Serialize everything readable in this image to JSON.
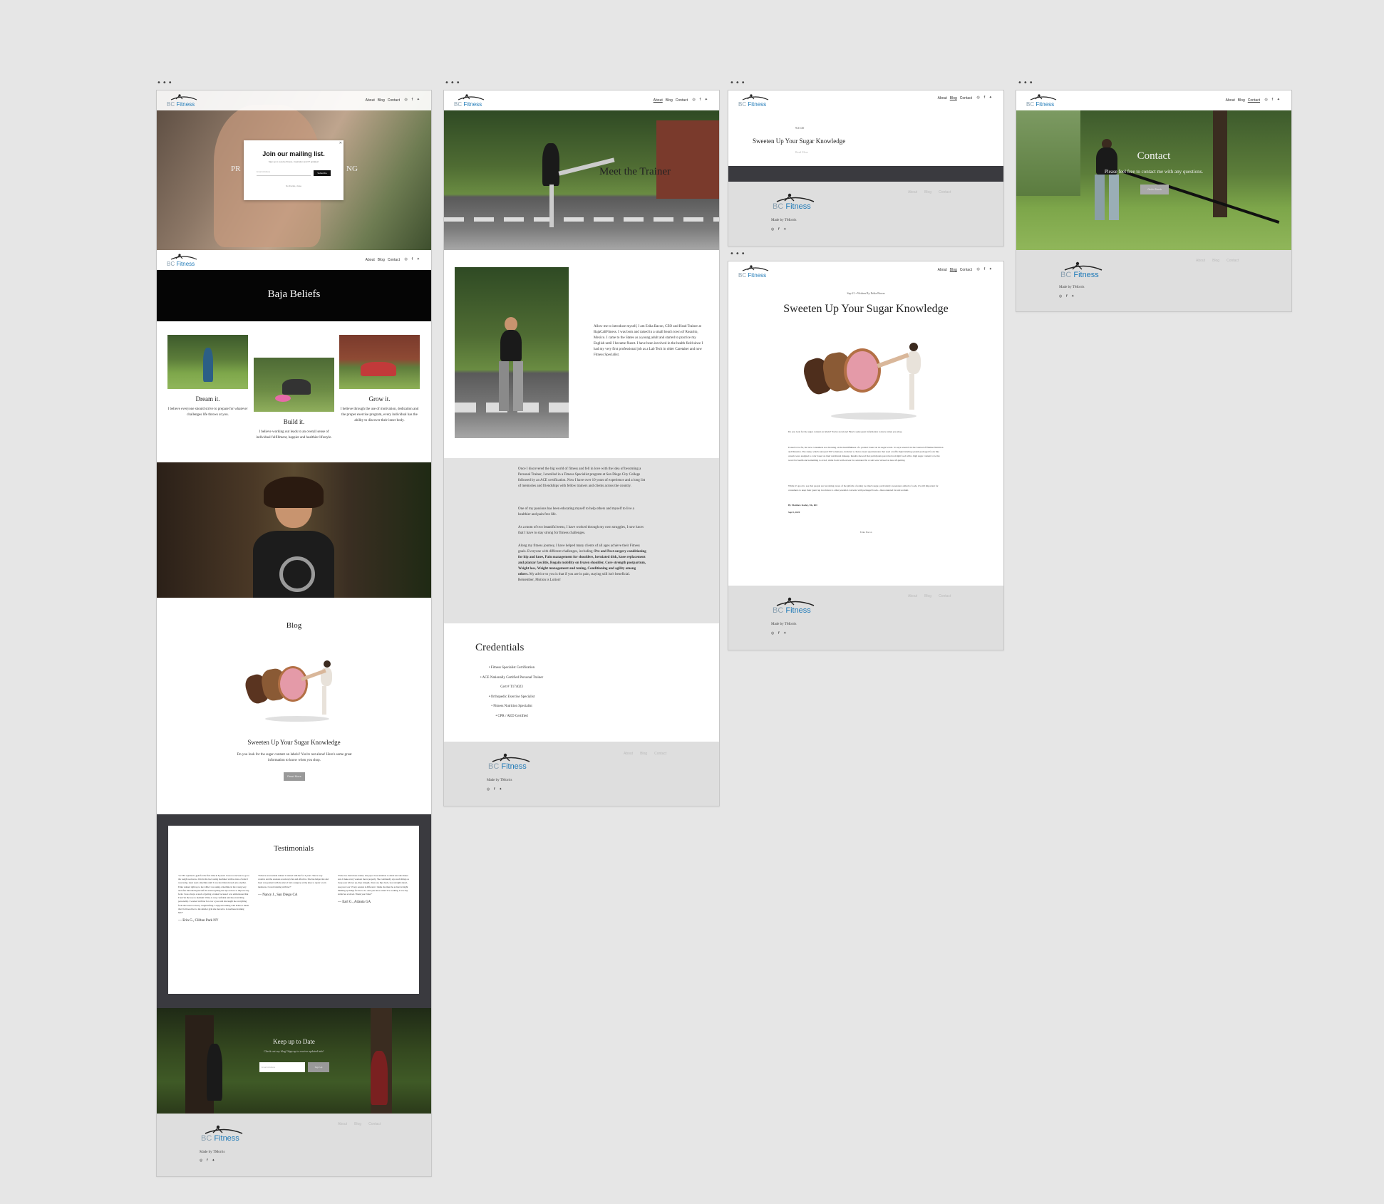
{
  "nav": {
    "logo_bc": "BC",
    "logo_fitness": "Fitness",
    "links": [
      "About",
      "Blog",
      "Contact"
    ],
    "social_icons": [
      "instagram-icon",
      "facebook-icon",
      "twitter-icon"
    ],
    "social_glyphs": "◎ f ✦"
  },
  "colors": {
    "page_bg": "#e6e6e6",
    "brand": "#1f7ab8",
    "footer_bg": "#dedede",
    "dark_band": "#3a3a3f"
  },
  "home": {
    "hero_left": "PR",
    "hero_right": "NG",
    "popup": {
      "title": "Join our mailing list.",
      "subtitle": "Sign up to receive fitness, inspiration and IT updates!",
      "email_placeholder": "Email Address",
      "submit": "Subscribe",
      "no_thanks": "No thanks, close"
    },
    "beliefs_title": "Baja Beliefs",
    "beliefs": [
      {
        "title": "Dream it.",
        "text": "I believe everyone should strive to prepare for whatever challenges life throws at you."
      },
      {
        "title": "Build it.",
        "text": "I believe working out leads to an overall sense of individual fulfillment, happier and healthier lifestyle."
      },
      {
        "title": "Grow it.",
        "text": "I believe through the use of motivation, dedication and the proper exercise program, every individual has the ability to discover their inner body."
      }
    ],
    "blog_title": "Blog",
    "blog_post_title": "Sweeten Up Your Sugar Knowledge",
    "blog_post_excerpt": "Do you look for the sugar content on labels? You're not alone! Here's some great information to know when you shop.",
    "read_more": "Read More",
    "testimonials_title": "Testimonials",
    "testimonials": [
      {
        "quote": "\"At 58 I rejoined a gym for the first time in 8 years! I was too nervous to go to the weight section so I hid in the back using machines with no idea of what I was doing. I just used a machine until I was tired then moved onto another. Erika walked right up to me while I was using a machine in the wrong way and after introducing herself she started giving me tips on how to improve my form. I was always scared of getting a trainer because I was embarrassed that I had 'let the lose to medium'. Erika is very confident and has an inviting personality. I worked with her for over a year and she taught me everything from the basics to heavy weight lifting. I enjoyed training with Erika so much that I followed her to the smaller gym she moved to in northeast training hub!\"",
        "author": "— Erin G., Clifton Park NY"
      },
      {
        "quote": "\"Erika is an excellent trainer! I trained with her for 3 years. She is very creative and the sessions are always fun and effective. She has helped me and been very patient with me since I had a surgery on my knee to repair a torn meniscus. I loved training with her!\"",
        "author": "— Nancy J., San Diego CA"
      },
      {
        "quote": "\"Erika is a marvelous trainer, she pays close attention to detail and she makes sure I make every workout move properly. She continually says such things as 'keep your elbows up, hips straight, chest out, hips back, look straight ahead, use your core'. Every session is different. I thank she must be as hard at night thinking up things for me to do. And you know what? It's working. I love my stride has evolved. Thank you Erika!\"",
        "author": "— Earl G., Atlanta GA"
      }
    ],
    "keep_title": "Keep up to Date",
    "keep_sub": "Check out my blog! Sign up to receive updated info!",
    "keep_placeholder": "Email Address",
    "keep_button": "Sign Up",
    "made_by": "Made by TMorris"
  },
  "about": {
    "hero_title": "Meet the Trainer",
    "intro": "Allow me to introduce myself, I am Erika Bacon, CEO and Head Trainer at BajaCaliFitness. I was born and raised in a small beach town of Rosarito, Mexico. I came to the States as a young adult and started to practice my English until I became fluent. I have been involved in the health field since I had my very first professional job as a Lab Tech in older Caretaker and now Fitness Specialist.",
    "story_1": "Once I discovered the big world of fitness and fell in love with the idea of becoming a Personal Trainer, I enrolled in a Fitness Specialist program at San Diego City College followed by an ACE certification. Now I have over 10 years of experience and a long list of memories and friendships with fellow trainers and clients across the country.",
    "story_2": "One of my passions has been educating myself to help others and myself to live a healthier and pain free life.",
    "story_3": "As a mom of two beautiful teens, I have worked through my own struggles, I now know that I have to stay strong for fitness challenges.",
    "story_4_start": "Along my fitness journey, I have helped many clients of all ages achieve their Fitness goals. Everyone with different challenges, including:",
    "story_4_bold": "Pre and Post surgery conditioning for hip and knee, Pain management for shoulders, herniated disk, knee replacement and plantar fasciitis, Regain mobility on frozen shoulder, Core strength postpartum, Weight loss, Weight management and toning, Conditioning and agility among others.",
    "story_4_end": "My advice to you is that if you are in pain, staying still isn't beneficial. Remember, Motion is Lotion!",
    "credentials_title": "Credentials",
    "credentials": [
      "• Fitness Specialist Certification",
      "• ACE Nationally Certified Personal Trainer",
      "Cert # T174023",
      "• Orthopedic Exercise Specialist",
      "• Fitness Nutrition Specialist",
      "• CPR / AED Certified"
    ]
  },
  "blog_list": {
    "date": "9/21/20",
    "title": "Sweeten Up Your Sugar Knowledge",
    "read_more": "Read More"
  },
  "post": {
    "meta": "Sep 21  •  Written By Erika Bacon",
    "title": "Sweeten Up Your Sugar Knowledge",
    "lead": "Do you look for the sugar content on labels? You're not alone! Here's some great information to know when you shop.",
    "p1": "It used to be fat, but now consumers are checking on the healthfulness of a product based on its sugar levels. So says research in the Journal of Human Nutrition and Dietetics. The study, which surveyed 500 volunteers, included a choice-based questionnaire that used a traffic-light labeling system packaged foods like cereals were assigned a color based on their nutritional makeup. Results showed that participants perceived red-light food with a high sugar content to be the worst for health and something to avoid, while foods with excess fat, saturated fat or salt were viewed as less off-putting.",
    "p2": "While it's good to see that people are becoming aware of the pitfalls of eating too much sugar, particularly sweeteners added to foods, it's still important for consumers to keep their guard up in relation to other potential concerns with packaged foods—like saturated fat and sodium.",
    "byline": "By Matthew Kadey, Ms, RD",
    "date": "Sep 8, 2020",
    "author": "Erika Bacon"
  },
  "contact": {
    "title": "Contact",
    "sub": "Please feel free to contact me with any questions.",
    "button": "Get in Touch"
  }
}
